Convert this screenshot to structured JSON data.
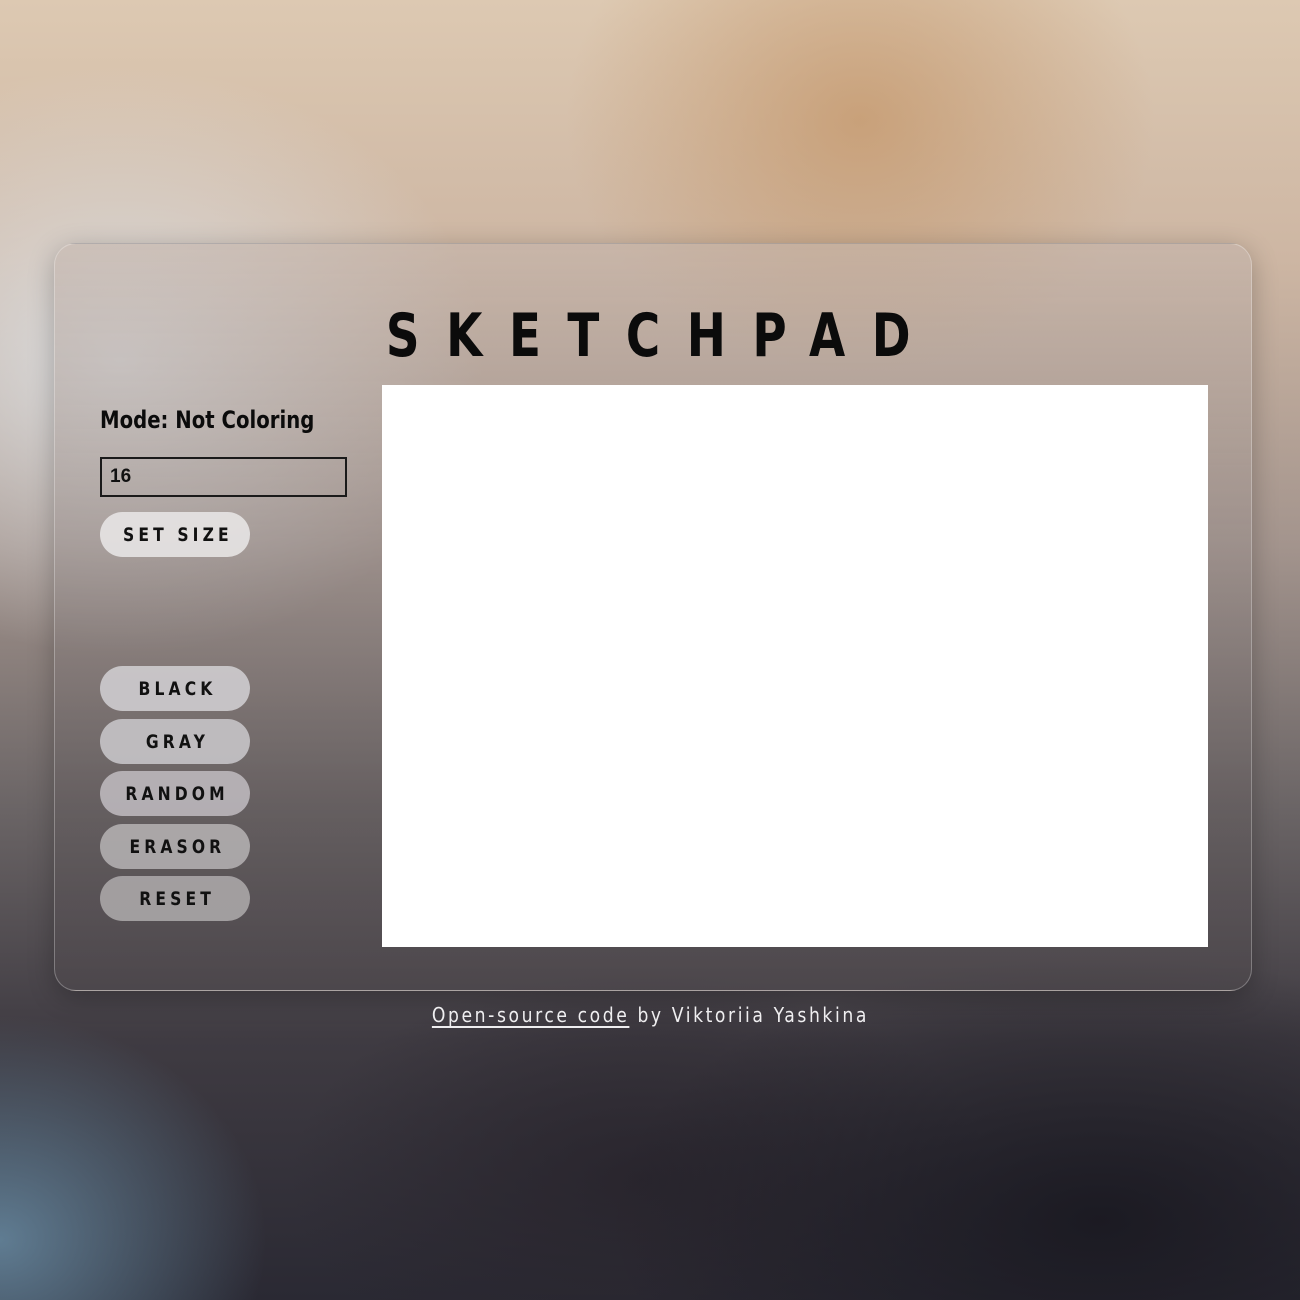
{
  "app": {
    "title": "SKETCHPAD"
  },
  "sidebar": {
    "mode_label": "Mode: Not Coloring",
    "size_input": {
      "value": "16",
      "placeholder": ""
    },
    "set_size_label": "SET SIZE",
    "color_buttons": [
      {
        "label": "BLACK"
      },
      {
        "label": "GRAY"
      },
      {
        "label": "RANDOM"
      },
      {
        "label": "ERASOR"
      },
      {
        "label": "RESET"
      }
    ]
  },
  "canvas": {
    "background": "#ffffff"
  },
  "footer": {
    "link_text": "Open-source code",
    "author_text": " by Viktoriia Yashkina"
  }
}
